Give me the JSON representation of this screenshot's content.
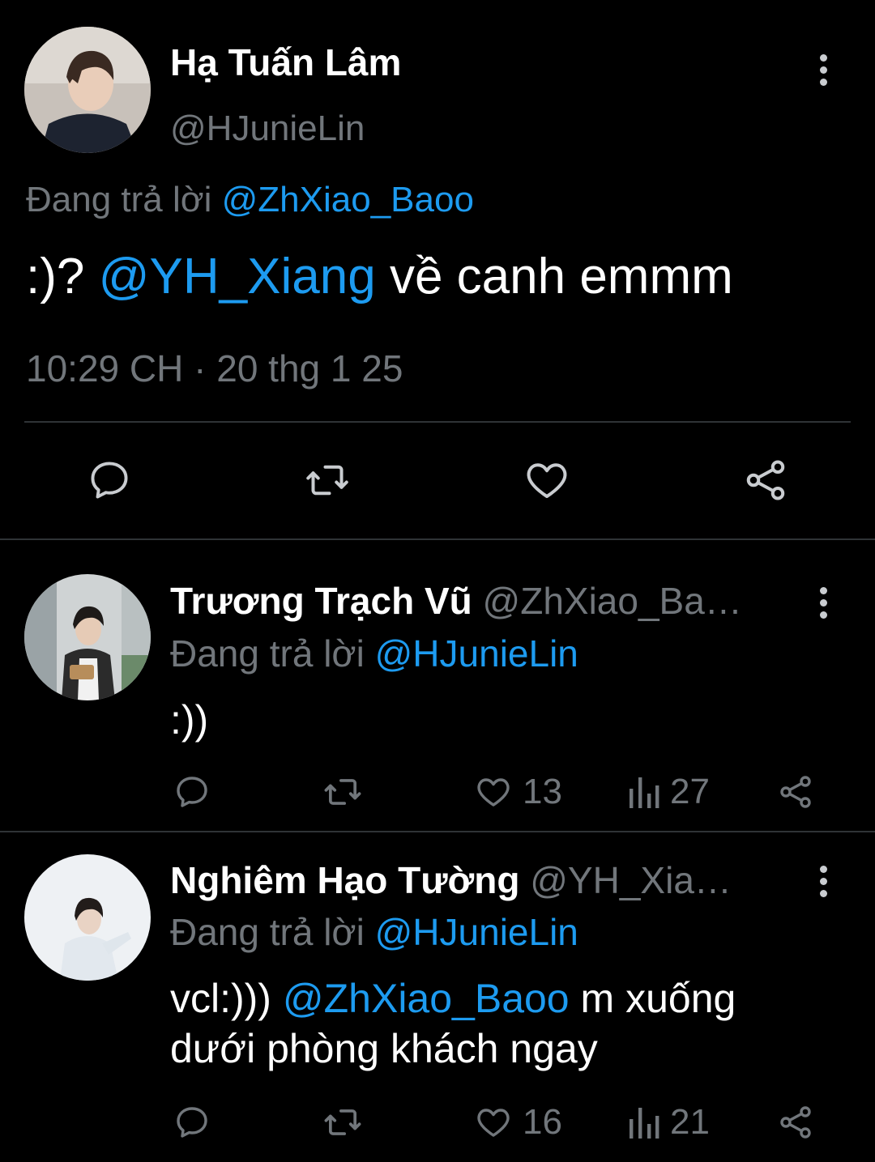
{
  "main_tweet": {
    "author_name": "Hạ Tuấn Lâm",
    "author_handle": "@HJunieLin",
    "replying_label": "Đang trả lời",
    "replying_to": "@ZhXiao_Baoo",
    "text_prefix": ":)?",
    "mention": "@YH_Xiang",
    "text_suffix": "về canh emmm",
    "time": "10:29 CH",
    "date_sep": "·",
    "date": "20 thg 1 25",
    "actions": [
      "reply-icon",
      "retweet-icon",
      "like-icon",
      "share-icon"
    ]
  },
  "replies": [
    {
      "author_name": "Trương Trạch Vũ",
      "author_handle": "@ZhXiao_Ba…",
      "replying_label": "Đang trả lời",
      "replying_to": "@HJunieLin",
      "text": ":))",
      "likes": "13",
      "views": "27"
    },
    {
      "author_name": "Nghiêm Hạo Tường",
      "author_handle": "@YH_Xia…",
      "replying_label": "Đang trả lời",
      "replying_to": "@HJunieLin",
      "text_prefix": "vcl:)))",
      "mention": "@ZhXiao_Baoo",
      "text_suffix": "m xuống dưới phòng khách ngay",
      "likes": "16",
      "views": "21"
    }
  ],
  "colors": {
    "background": "#000000",
    "link": "#1d9bf0",
    "muted": "#71767b",
    "divider": "#2f3336"
  }
}
